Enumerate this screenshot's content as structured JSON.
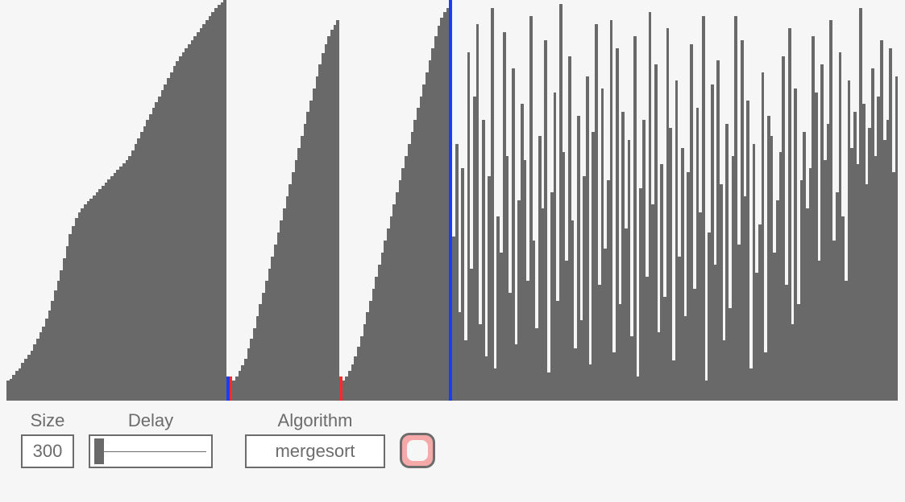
{
  "controls": {
    "size_label": "Size",
    "size_value": "300",
    "delay_label": "Delay",
    "delay_value": 0.02,
    "algorithm_label": "Algorithm",
    "algorithm_value": "mergesort"
  },
  "colors": {
    "bar": "#696969",
    "marker_red": "#ff2a2a",
    "marker_blue": "#1a3cff",
    "bg": "#f6f6f6",
    "border": "#6c6c6c",
    "record_fill": "#f6a9a9"
  },
  "chart_data": {
    "type": "bar",
    "title": "",
    "xlabel": "",
    "ylabel": "",
    "ylim": [
      0,
      1
    ],
    "n": 300,
    "markers": [
      {
        "index": 74,
        "color": "blue",
        "value": 0.06
      },
      {
        "index": 75,
        "color": "red",
        "value": 0.06
      },
      {
        "index": 112,
        "color": "red",
        "value": 0.06
      },
      {
        "index": 149,
        "color": "blue",
        "value": 1.0
      }
    ],
    "segments": [
      {
        "start": 0,
        "end": 73,
        "kind": "sorted_asc",
        "from": 0.05,
        "to": 1.0
      },
      {
        "start": 76,
        "end": 111,
        "kind": "sorted_asc",
        "from": 0.05,
        "to": 0.95
      },
      {
        "start": 113,
        "end": 148,
        "kind": "sorted_asc",
        "from": 0.05,
        "to": 0.98
      },
      {
        "start": 150,
        "end": 299,
        "kind": "random",
        "min": 0.05,
        "max": 1.0
      }
    ],
    "values": [
      0.05,
      0.055,
      0.065,
      0.075,
      0.08,
      0.095,
      0.105,
      0.115,
      0.125,
      0.14,
      0.155,
      0.17,
      0.185,
      0.205,
      0.225,
      0.25,
      0.275,
      0.3,
      0.325,
      0.355,
      0.385,
      0.415,
      0.435,
      0.455,
      0.47,
      0.48,
      0.49,
      0.498,
      0.505,
      0.512,
      0.52,
      0.528,
      0.536,
      0.544,
      0.552,
      0.56,
      0.568,
      0.576,
      0.584,
      0.592,
      0.6,
      0.61,
      0.625,
      0.64,
      0.655,
      0.67,
      0.685,
      0.7,
      0.715,
      0.73,
      0.745,
      0.76,
      0.775,
      0.79,
      0.805,
      0.82,
      0.835,
      0.848,
      0.86,
      0.87,
      0.88,
      0.89,
      0.9,
      0.91,
      0.92,
      0.93,
      0.94,
      0.95,
      0.96,
      0.97,
      0.98,
      0.988,
      0.994,
      1.0,
      0.06,
      0.06,
      0.05,
      0.06,
      0.075,
      0.088,
      0.105,
      0.13,
      0.155,
      0.18,
      0.21,
      0.24,
      0.27,
      0.3,
      0.33,
      0.36,
      0.39,
      0.42,
      0.45,
      0.48,
      0.51,
      0.54,
      0.57,
      0.6,
      0.63,
      0.66,
      0.69,
      0.72,
      0.75,
      0.78,
      0.81,
      0.84,
      0.868,
      0.89,
      0.91,
      0.925,
      0.938,
      0.95,
      0.06,
      0.05,
      0.06,
      0.075,
      0.09,
      0.11,
      0.135,
      0.16,
      0.19,
      0.22,
      0.25,
      0.28,
      0.31,
      0.34,
      0.37,
      0.4,
      0.43,
      0.46,
      0.49,
      0.52,
      0.55,
      0.58,
      0.61,
      0.64,
      0.67,
      0.7,
      0.73,
      0.76,
      0.79,
      0.82,
      0.85,
      0.88,
      0.91,
      0.935,
      0.955,
      0.97,
      0.98,
      1.0,
      0.41,
      0.64,
      0.22,
      0.58,
      0.15,
      0.87,
      0.33,
      0.76,
      0.94,
      0.19,
      0.7,
      0.11,
      0.56,
      0.98,
      0.08,
      0.46,
      0.37,
      0.92,
      0.61,
      0.27,
      0.83,
      0.14,
      0.5,
      0.74,
      0.6,
      0.3,
      0.96,
      0.4,
      0.18,
      0.66,
      0.48,
      0.9,
      0.07,
      0.52,
      0.77,
      0.25,
      0.99,
      0.62,
      0.35,
      0.86,
      0.45,
      0.13,
      0.71,
      0.2,
      0.56,
      0.81,
      0.09,
      0.67,
      0.94,
      0.29,
      0.78,
      0.38,
      0.55,
      0.95,
      0.12,
      0.88,
      0.24,
      0.72,
      0.43,
      0.65,
      0.16,
      0.91,
      0.06,
      0.53,
      0.7,
      0.31,
      0.97,
      0.49,
      0.84,
      0.17,
      0.59,
      0.26,
      0.93,
      0.68,
      0.1,
      0.8,
      0.36,
      0.63,
      0.21,
      0.57,
      0.89,
      0.28,
      0.73,
      0.47,
      0.96,
      0.05,
      0.42,
      0.79,
      0.34,
      0.85,
      0.54,
      0.15,
      0.69,
      0.23,
      0.61,
      0.96,
      0.39,
      0.9,
      0.51,
      0.75,
      0.08,
      0.64,
      0.32,
      0.44,
      0.82,
      0.12,
      0.71,
      0.66,
      0.37,
      0.5,
      0.62,
      0.86,
      0.29,
      0.93,
      0.19,
      0.78,
      0.24,
      0.55,
      0.67,
      0.48,
      0.58,
      0.91,
      0.77,
      0.35,
      0.84,
      0.6,
      0.69,
      0.95,
      0.4,
      0.52,
      0.87,
      0.46,
      0.3,
      0.8,
      0.63,
      0.72,
      0.59,
      0.98,
      0.74,
      0.54,
      0.68,
      0.83,
      0.61,
      0.76,
      0.9,
      0.65,
      0.7,
      0.88,
      0.57,
      0.81
    ]
  }
}
